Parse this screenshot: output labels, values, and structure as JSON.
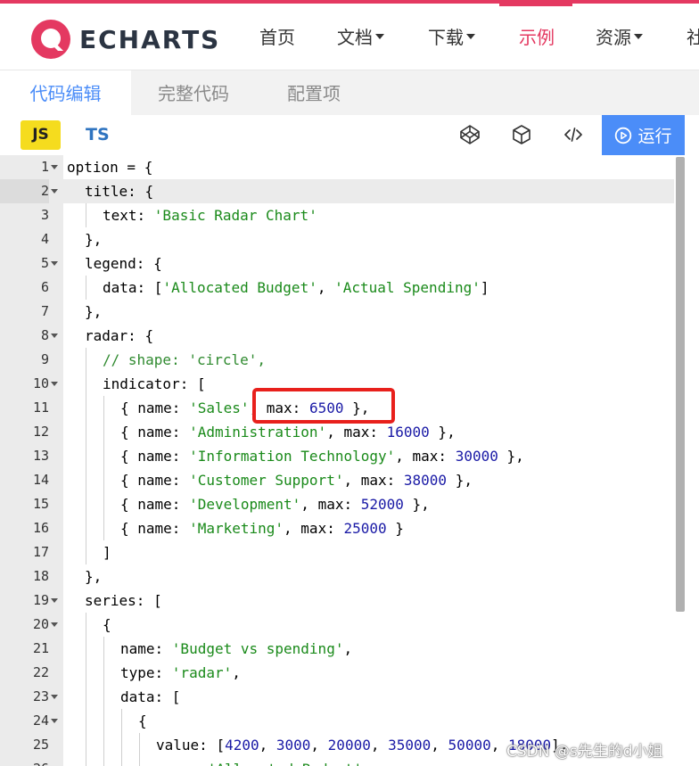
{
  "brand": {
    "logo_text": "ECHARTS",
    "accent": "#e43961"
  },
  "nav": {
    "items": [
      {
        "label": "首页",
        "dropdown": false,
        "active": false
      },
      {
        "label": "文档",
        "dropdown": true,
        "active": false
      },
      {
        "label": "下载",
        "dropdown": true,
        "active": false
      },
      {
        "label": "示例",
        "dropdown": false,
        "active": true
      },
      {
        "label": "资源",
        "dropdown": true,
        "active": false
      },
      {
        "label": "社",
        "dropdown": false,
        "active": false
      }
    ]
  },
  "tabs": [
    {
      "label": "代码编辑",
      "active": true
    },
    {
      "label": "完整代码",
      "active": false
    },
    {
      "label": "配置项",
      "active": false
    }
  ],
  "toolbar": {
    "lang_js": "JS",
    "lang_ts": "TS",
    "icons": [
      "codepen-icon",
      "codesandbox-icon",
      "embed-code-icon"
    ],
    "run_label": "运行",
    "run_color": "#4b8df8"
  },
  "editor": {
    "current_line": 2,
    "lines": [
      {
        "n": "1",
        "fold": true,
        "indent": 0,
        "tokens": [
          [
            "k",
            "option"
          ],
          [
            "p",
            " = {"
          ]
        ]
      },
      {
        "n": "2",
        "fold": true,
        "indent": 1,
        "tokens": [
          [
            "k",
            "title"
          ],
          [
            "p",
            ": {"
          ]
        ]
      },
      {
        "n": "3",
        "fold": false,
        "indent": 2,
        "tokens": [
          [
            "k",
            "text"
          ],
          [
            "p",
            ": "
          ],
          [
            "s",
            "'Basic Radar Chart'"
          ]
        ]
      },
      {
        "n": "4",
        "fold": false,
        "indent": 1,
        "tokens": [
          [
            "p",
            "},"
          ]
        ]
      },
      {
        "n": "5",
        "fold": true,
        "indent": 1,
        "tokens": [
          [
            "k",
            "legend"
          ],
          [
            "p",
            ": {"
          ]
        ]
      },
      {
        "n": "6",
        "fold": false,
        "indent": 2,
        "tokens": [
          [
            "k",
            "data"
          ],
          [
            "p",
            ": ["
          ],
          [
            "s",
            "'Allocated Budget'"
          ],
          [
            "p",
            ", "
          ],
          [
            "s",
            "'Actual Spending'"
          ],
          [
            "p",
            "]"
          ]
        ]
      },
      {
        "n": "7",
        "fold": false,
        "indent": 1,
        "tokens": [
          [
            "p",
            "},"
          ]
        ]
      },
      {
        "n": "8",
        "fold": true,
        "indent": 1,
        "tokens": [
          [
            "k",
            "radar"
          ],
          [
            "p",
            ": {"
          ]
        ]
      },
      {
        "n": "9",
        "fold": false,
        "indent": 2,
        "tokens": [
          [
            "c",
            "// shape: 'circle',"
          ]
        ]
      },
      {
        "n": "10",
        "fold": true,
        "indent": 2,
        "tokens": [
          [
            "k",
            "indicator"
          ],
          [
            "p",
            ": ["
          ]
        ]
      },
      {
        "n": "11",
        "fold": false,
        "indent": 3,
        "tokens": [
          [
            "p",
            "{ "
          ],
          [
            "k",
            "name"
          ],
          [
            "p",
            ": "
          ],
          [
            "s",
            "'Sales'"
          ],
          [
            "p",
            ", "
          ],
          [
            "k",
            "max"
          ],
          [
            "p",
            ": "
          ],
          [
            "n",
            "6500"
          ],
          [
            "p",
            " },"
          ]
        ]
      },
      {
        "n": "12",
        "fold": false,
        "indent": 3,
        "tokens": [
          [
            "p",
            "{ "
          ],
          [
            "k",
            "name"
          ],
          [
            "p",
            ": "
          ],
          [
            "s",
            "'Administration'"
          ],
          [
            "p",
            ", "
          ],
          [
            "k",
            "max"
          ],
          [
            "p",
            ": "
          ],
          [
            "n",
            "16000"
          ],
          [
            "p",
            " },"
          ]
        ]
      },
      {
        "n": "13",
        "fold": false,
        "indent": 3,
        "tokens": [
          [
            "p",
            "{ "
          ],
          [
            "k",
            "name"
          ],
          [
            "p",
            ": "
          ],
          [
            "s",
            "'Information Technology'"
          ],
          [
            "p",
            ", "
          ],
          [
            "k",
            "max"
          ],
          [
            "p",
            ": "
          ],
          [
            "n",
            "30000"
          ],
          [
            "p",
            " },"
          ]
        ]
      },
      {
        "n": "14",
        "fold": false,
        "indent": 3,
        "tokens": [
          [
            "p",
            "{ "
          ],
          [
            "k",
            "name"
          ],
          [
            "p",
            ": "
          ],
          [
            "s",
            "'Customer Support'"
          ],
          [
            "p",
            ", "
          ],
          [
            "k",
            "max"
          ],
          [
            "p",
            ": "
          ],
          [
            "n",
            "38000"
          ],
          [
            "p",
            " },"
          ]
        ]
      },
      {
        "n": "15",
        "fold": false,
        "indent": 3,
        "tokens": [
          [
            "p",
            "{ "
          ],
          [
            "k",
            "name"
          ],
          [
            "p",
            ": "
          ],
          [
            "s",
            "'Development'"
          ],
          [
            "p",
            ", "
          ],
          [
            "k",
            "max"
          ],
          [
            "p",
            ": "
          ],
          [
            "n",
            "52000"
          ],
          [
            "p",
            " },"
          ]
        ]
      },
      {
        "n": "16",
        "fold": false,
        "indent": 3,
        "tokens": [
          [
            "p",
            "{ "
          ],
          [
            "k",
            "name"
          ],
          [
            "p",
            ": "
          ],
          [
            "s",
            "'Marketing'"
          ],
          [
            "p",
            ", "
          ],
          [
            "k",
            "max"
          ],
          [
            "p",
            ": "
          ],
          [
            "n",
            "25000"
          ],
          [
            "p",
            " }"
          ]
        ]
      },
      {
        "n": "17",
        "fold": false,
        "indent": 2,
        "tokens": [
          [
            "p",
            "]"
          ]
        ]
      },
      {
        "n": "18",
        "fold": false,
        "indent": 1,
        "tokens": [
          [
            "p",
            "},"
          ]
        ]
      },
      {
        "n": "19",
        "fold": true,
        "indent": 1,
        "tokens": [
          [
            "k",
            "series"
          ],
          [
            "p",
            ": ["
          ]
        ]
      },
      {
        "n": "20",
        "fold": true,
        "indent": 2,
        "tokens": [
          [
            "p",
            "{"
          ]
        ]
      },
      {
        "n": "21",
        "fold": false,
        "indent": 3,
        "tokens": [
          [
            "k",
            "name"
          ],
          [
            "p",
            ": "
          ],
          [
            "s",
            "'Budget vs spending'"
          ],
          [
            "p",
            ","
          ]
        ]
      },
      {
        "n": "22",
        "fold": false,
        "indent": 3,
        "tokens": [
          [
            "k",
            "type"
          ],
          [
            "p",
            ": "
          ],
          [
            "s",
            "'radar'"
          ],
          [
            "p",
            ","
          ]
        ]
      },
      {
        "n": "23",
        "fold": true,
        "indent": 3,
        "tokens": [
          [
            "k",
            "data"
          ],
          [
            "p",
            ": ["
          ]
        ]
      },
      {
        "n": "24",
        "fold": true,
        "indent": 4,
        "tokens": [
          [
            "p",
            "{"
          ]
        ]
      },
      {
        "n": "25",
        "fold": false,
        "indent": 5,
        "tokens": [
          [
            "k",
            "value"
          ],
          [
            "p",
            ": ["
          ],
          [
            "n",
            "4200"
          ],
          [
            "p",
            ", "
          ],
          [
            "n",
            "3000"
          ],
          [
            "p",
            ", "
          ],
          [
            "n",
            "20000"
          ],
          [
            "p",
            ", "
          ],
          [
            "n",
            "35000"
          ],
          [
            "p",
            ", "
          ],
          [
            "n",
            "50000"
          ],
          [
            "p",
            ", "
          ],
          [
            "n",
            "18000"
          ],
          [
            "p",
            "],"
          ]
        ]
      },
      {
        "n": "26",
        "fold": false,
        "indent": 5,
        "tokens": [
          [
            "k",
            "name"
          ],
          [
            "p",
            ": "
          ],
          [
            "s",
            "'Allocated Budget'"
          ]
        ]
      }
    ]
  },
  "watermark": "CSDN @s先生的d小姐"
}
